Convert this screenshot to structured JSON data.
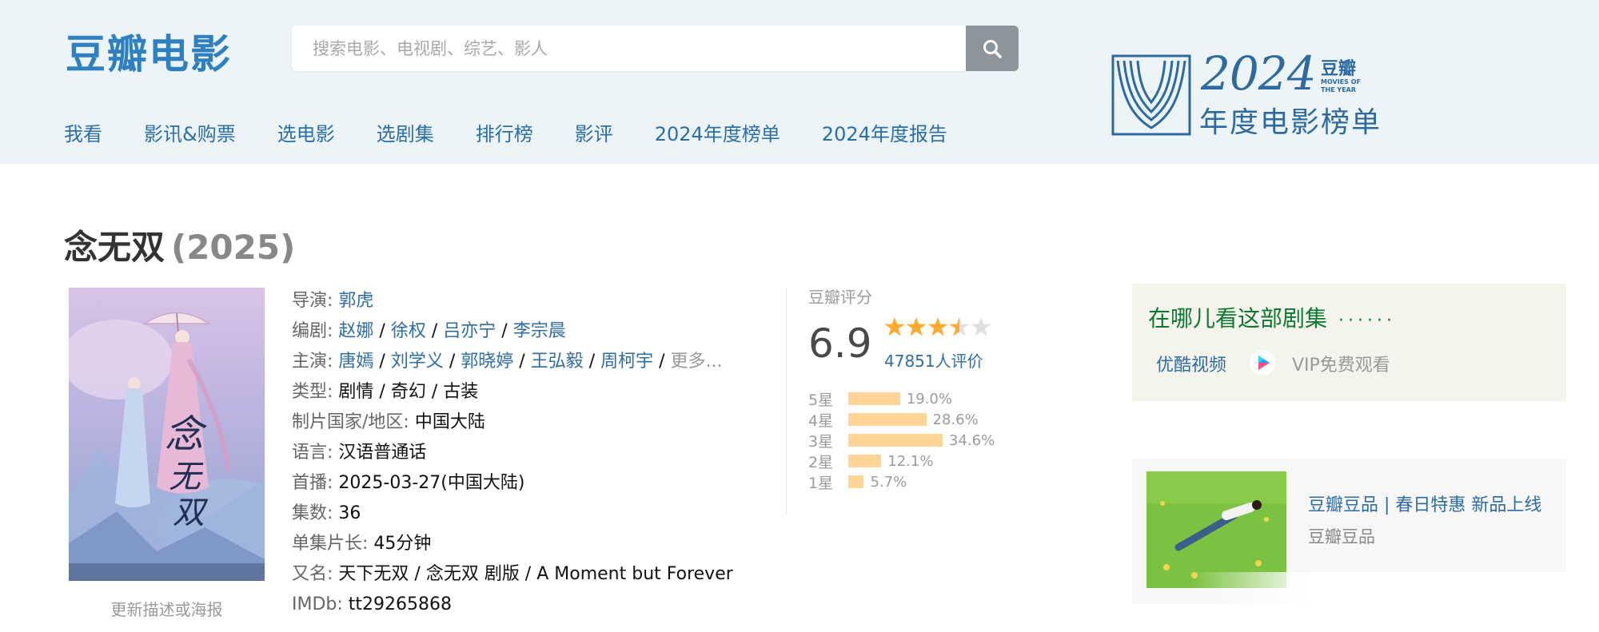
{
  "header": {
    "logo": "豆瓣电影",
    "search_placeholder": "搜索电影、电视剧、综艺、影人",
    "nav": [
      "我看",
      "影讯&购票",
      "选电影",
      "选剧集",
      "排行榜",
      "影评",
      "2024年度榜单",
      "2024年度报告"
    ],
    "annual": {
      "year": "2024",
      "brand": "豆瓣",
      "tagline": "MOVIES OF THE YEAR",
      "subtitle": "年度电影榜单"
    }
  },
  "subject": {
    "name": "念无双",
    "year": "(2025)",
    "poster_link": "更新描述或海报"
  },
  "info": {
    "director_label": "导演:",
    "director": "郭虎",
    "writer_label": "编剧:",
    "writers": [
      "赵娜",
      "徐权",
      "吕亦宁",
      "李宗晨"
    ],
    "cast_label": "主演:",
    "cast": [
      "唐嫣",
      "刘学义",
      "郭晓婷",
      "王弘毅",
      "周柯宇"
    ],
    "cast_more": "更多...",
    "genre_label": "类型:",
    "genre": "剧情 / 奇幻 / 古装",
    "country_label": "制片国家/地区:",
    "country": "中国大陆",
    "language_label": "语言:",
    "language": "汉语普通话",
    "premiere_label": "首播:",
    "premiere": "2025-03-27(中国大陆)",
    "episodes_label": "集数:",
    "episodes": "36",
    "runtime_label": "单集片长:",
    "runtime": "45分钟",
    "aka_label": "又名:",
    "aka": "天下无双 / 念无双 剧版 / A Moment but Forever",
    "imdb_label": "IMDb:",
    "imdb": "tt29265868"
  },
  "rating": {
    "title": "豆瓣评分",
    "score": "6.9",
    "stars": 3.5,
    "count": "47851人评价",
    "distribution": [
      {
        "label": "5星",
        "pct": "19.0%",
        "value": 19.0
      },
      {
        "label": "4星",
        "pct": "28.6%",
        "value": 28.6
      },
      {
        "label": "3星",
        "pct": "34.6%",
        "value": 34.6
      },
      {
        "label": "2星",
        "pct": "12.1%",
        "value": 12.1
      },
      {
        "label": "1星",
        "pct": "5.7%",
        "value": 5.7
      }
    ]
  },
  "watch": {
    "title": "在哪儿看这部剧集",
    "dots": "······",
    "platform": "优酷视频",
    "vip": "VIP免费观看"
  },
  "ad": {
    "title": "豆瓣豆品 | 春日特惠 新品上线",
    "sub": "豆瓣豆品"
  },
  "colors": {
    "link": "#2e6ca6",
    "header_bg": "#edf4f7",
    "star": "#ffac2d",
    "bar": "#ffd596",
    "watch_title": "#0b7a2e"
  }
}
